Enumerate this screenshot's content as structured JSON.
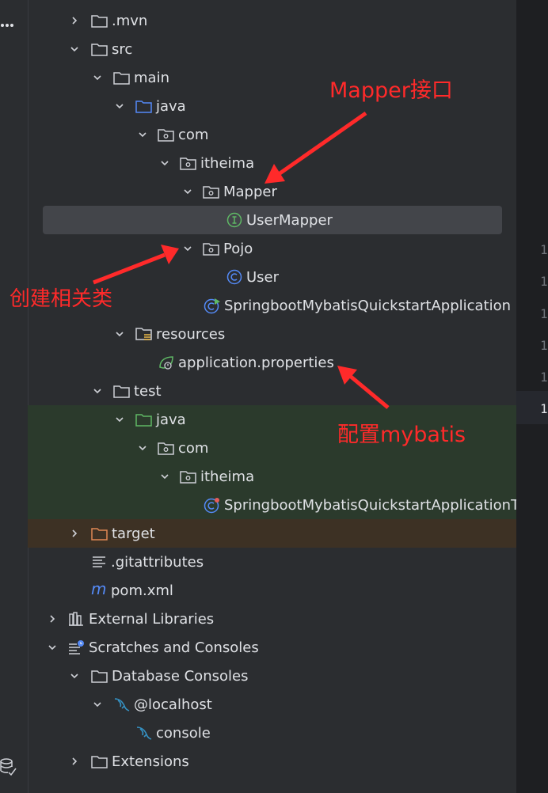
{
  "tree": {
    "items": [
      {
        "label": ".mvn"
      },
      {
        "label": "src"
      },
      {
        "label": "main"
      },
      {
        "label": "java"
      },
      {
        "label": "com"
      },
      {
        "label": "itheima"
      },
      {
        "label": "Mapper"
      },
      {
        "label": "UserMapper"
      },
      {
        "label": "Pojo"
      },
      {
        "label": "User"
      },
      {
        "label": "SpringbootMybatisQuickstartApplication"
      },
      {
        "label": "resources"
      },
      {
        "label": "application.properties"
      },
      {
        "label": "test"
      },
      {
        "label": "java"
      },
      {
        "label": "com"
      },
      {
        "label": "itheima"
      },
      {
        "label": "SpringbootMybatisQuickstartApplicationT"
      },
      {
        "label": "target"
      },
      {
        "label": ".gitattributes"
      },
      {
        "label": "pom.xml"
      },
      {
        "label": "External Libraries"
      },
      {
        "label": "Scratches and Consoles"
      },
      {
        "label": "Database Consoles"
      },
      {
        "label": "@localhost"
      },
      {
        "label": "console"
      },
      {
        "label": "Extensions"
      }
    ]
  },
  "gutter": [
    "1",
    "1",
    "1",
    "1",
    "1",
    "1"
  ],
  "annotations": {
    "mapper": "Mapper接口",
    "create": "创建相关类",
    "config": "配置mybatis"
  },
  "colors": {
    "annotation": "#ff2a2a",
    "test_highlight": "#2b3a2c",
    "excluded_highlight": "#3d3124",
    "selected_row": "#43454a"
  }
}
